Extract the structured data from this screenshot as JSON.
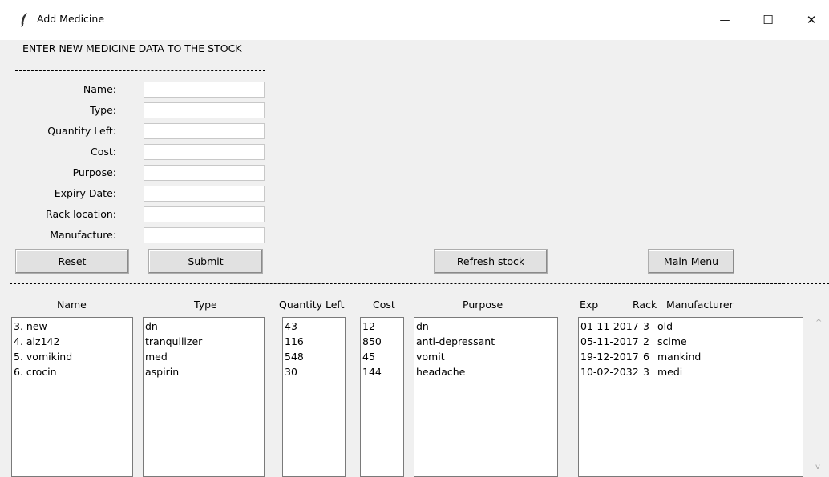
{
  "window": {
    "title": "Add Medicine",
    "controls": {
      "minimize": "—",
      "maximize": "☐",
      "close": "✕"
    }
  },
  "form": {
    "heading": "ENTER NEW MEDICINE DATA TO THE STOCK",
    "fields": [
      {
        "label": "Name:",
        "value": ""
      },
      {
        "label": "Type:",
        "value": ""
      },
      {
        "label": "Quantity Left:",
        "value": ""
      },
      {
        "label": "Cost:",
        "value": ""
      },
      {
        "label": "Purpose:",
        "value": ""
      },
      {
        "label": "Expiry Date:",
        "value": ""
      },
      {
        "label": "Rack location:",
        "value": ""
      },
      {
        "label": "Manufacture:",
        "value": ""
      }
    ]
  },
  "buttons": {
    "reset": "Reset",
    "submit": "Submit",
    "refresh": "Refresh stock",
    "main_menu": "Main Menu"
  },
  "table": {
    "headers": {
      "name": "Name",
      "type": "Type",
      "quantity": "Quantity Left",
      "cost": "Cost",
      "purpose": "Purpose",
      "exp": "Exp",
      "rack": "Rack",
      "manufacturer": "Manufacturer"
    },
    "names": [
      "3. new",
      "4. alz142",
      "5. vomikind",
      "6. crocin"
    ],
    "types": [
      "dn",
      "tranquilizer",
      "med",
      "aspirin"
    ],
    "quantities": [
      "43",
      "116",
      "548",
      "30"
    ],
    "costs": [
      "12",
      "850",
      "45",
      "144"
    ],
    "purposes": [
      "dn",
      "anti-depressant",
      "vomit",
      "headache"
    ],
    "details": [
      {
        "exp": "01-11-2017",
        "rack": "3",
        "manufacturer": "old"
      },
      {
        "exp": "05-11-2017",
        "rack": "2",
        "manufacturer": "scime"
      },
      {
        "exp": "19-12-2017",
        "rack": "6",
        "manufacturer": "mankind"
      },
      {
        "exp": "10-02-2032",
        "rack": "3",
        "manufacturer": "medi"
      }
    ]
  },
  "scrollbar": {
    "up": "^",
    "down": "v"
  }
}
